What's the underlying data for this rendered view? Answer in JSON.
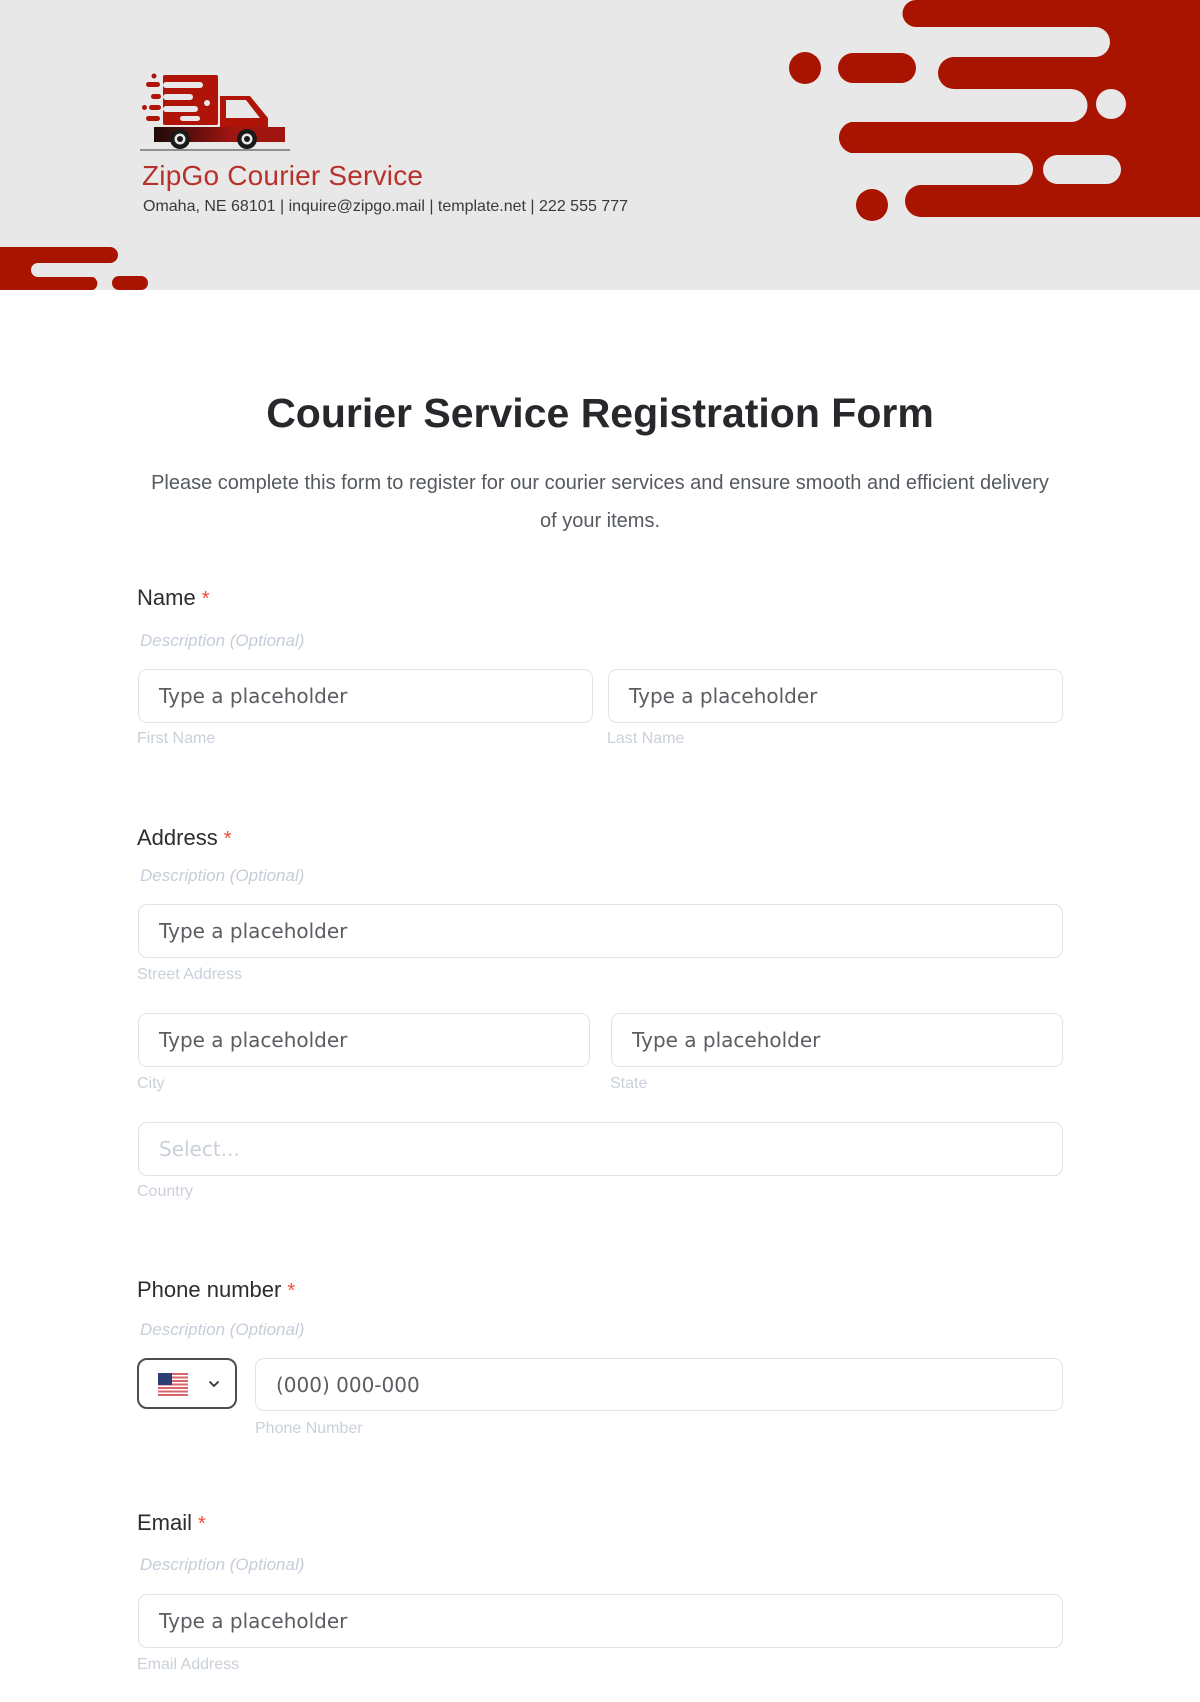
{
  "header": {
    "company_name": "ZipGo Courier Service",
    "company_info": "Omaha, NE 68101 | inquire@zipgo.mail | template.net | 222 555 777",
    "brand_color": "#a91400",
    "background_color": "#e8e8e8",
    "logo_icon": "delivery-truck-icon"
  },
  "form": {
    "title": "Courier Service Registration Form",
    "description": "Please complete this form to register for our courier services and ensure smooth and efficient delivery of your items.",
    "required_marker": "*",
    "sections": {
      "name": {
        "label": "Name",
        "description": "Description (Optional)",
        "first_placeholder": "Type a placeholder",
        "first_sublabel": "First Name",
        "last_placeholder": "Type a placeholder",
        "last_sublabel": "Last Name"
      },
      "address": {
        "label": "Address",
        "description": "Description (Optional)",
        "street_placeholder": "Type a placeholder",
        "street_sublabel": "Street Address",
        "city_placeholder": "Type a placeholder",
        "city_sublabel": "City",
        "state_placeholder": "Type a placeholder",
        "state_sublabel": "State",
        "country_placeholder": "Select...",
        "country_sublabel": "Country"
      },
      "phone": {
        "label": "Phone number",
        "description": "Description (Optional)",
        "country_code_flag": "us-flag-icon",
        "placeholder": "(000) 000-000",
        "sublabel": "Phone Number"
      },
      "email": {
        "label": "Email",
        "description": "Description (Optional)",
        "placeholder": "Type a placeholder",
        "sublabel": "Email Address"
      }
    }
  }
}
